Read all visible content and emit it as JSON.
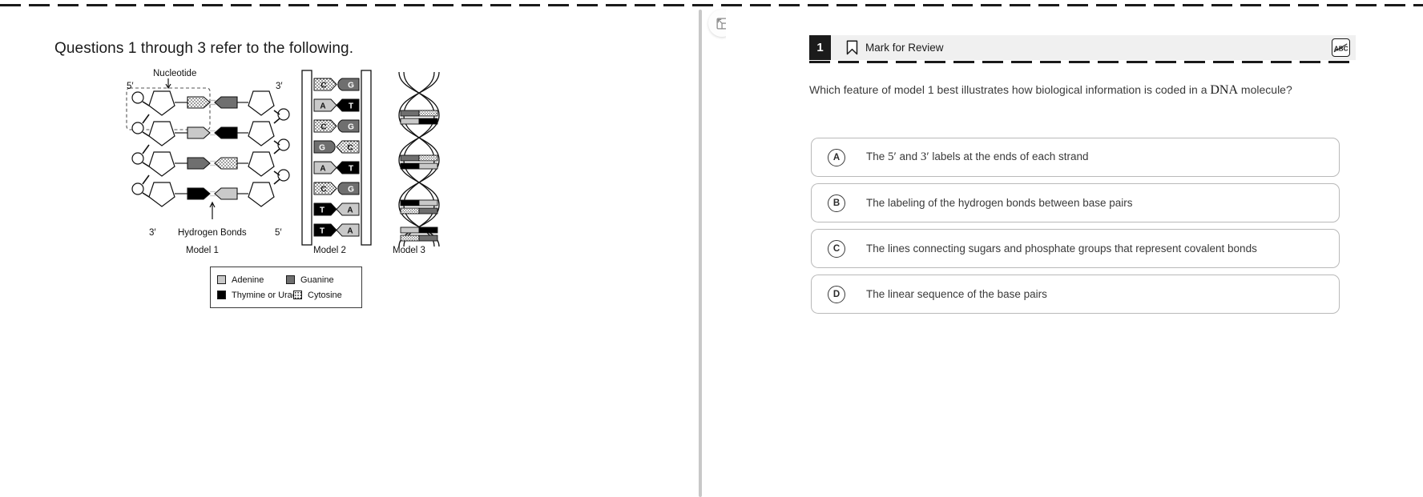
{
  "toolbar": {
    "expand_left_icon": "expand-panel-icon",
    "expand_right_icon": "collapse-panel-icon"
  },
  "stimulus": {
    "title": "Questions 1 through 3 refer to the following.",
    "figure": {
      "callout_nucleotide": "Nucleotide",
      "end_top_left": "5′",
      "end_top_right": "3′",
      "end_bottom_left": "3′",
      "end_bottom_right": "5′",
      "hydrogen_bonds_label": "Hydrogen Bonds",
      "model1_label": "Model 1",
      "model2_label": "Model 2",
      "model3_label": "Model 3",
      "model2_base_pairs": [
        {
          "left": "C",
          "right": "G"
        },
        {
          "left": "A",
          "right": "T"
        },
        {
          "left": "C",
          "right": "G"
        },
        {
          "left": "G",
          "right": "C"
        },
        {
          "left": "A",
          "right": "T"
        },
        {
          "left": "C",
          "right": "G"
        },
        {
          "left": "T",
          "right": "A"
        },
        {
          "left": "T",
          "right": "A"
        }
      ],
      "legend": [
        {
          "label": "Adenine",
          "swatch": "adenine",
          "color": "#c9c9c9"
        },
        {
          "label": "Guanine",
          "swatch": "guanine",
          "color": "#6f6f6f"
        },
        {
          "label": "Thymine or Uracil",
          "swatch": "thymine",
          "color": "#000000"
        },
        {
          "label": "Cytosine",
          "swatch": "cytosine",
          "color": "#ffffff"
        }
      ]
    }
  },
  "question": {
    "number": "1",
    "mark_for_review": "Mark for Review",
    "bookmark_icon": "bookmark-icon",
    "cross_out_icon": "abc-strikethrough-icon",
    "stem_before": "Which feature of model 1 best illustrates how biological information is coded in a ",
    "stem_dna": "DNA",
    "stem_after": " molecule?",
    "choices": [
      {
        "letter": "A",
        "text_before": "The ",
        "prime1": "5′",
        "text_mid": " and ",
        "prime2": "3′",
        "text_after": " labels at the ends of each strand",
        "full_text": "The 5′ and 3′ labels at the ends of each strand"
      },
      {
        "letter": "B",
        "full_text": "The labeling of the hydrogen bonds between base pairs"
      },
      {
        "letter": "C",
        "full_text": "The lines connecting sugars and phosphate groups that represent covalent bonds"
      },
      {
        "letter": "D",
        "full_text": "The linear sequence of the base pairs"
      }
    ]
  },
  "colors": {
    "header_bg": "#f0f0f0",
    "badge_bg": "#1b1b1b",
    "choice_border": "#b9b9b9",
    "divider": "#c8c8c8"
  }
}
